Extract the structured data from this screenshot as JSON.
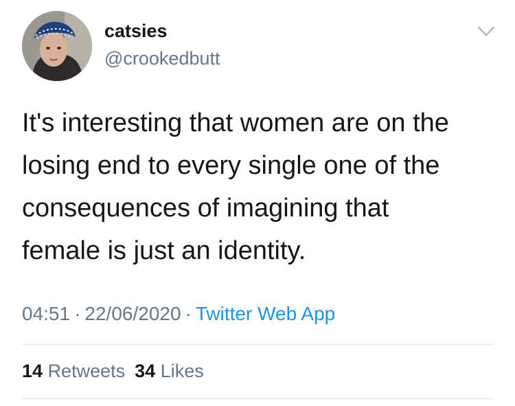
{
  "author": {
    "display_name": "catsies",
    "handle": "@crookedbutt",
    "avatar_icon": "profile-photo"
  },
  "tweet": {
    "text": "It's interesting that women are on the\nlosing end to every single one of the\nconsequences of imagining that\nfemale is just an identity."
  },
  "meta": {
    "time": "04:51",
    "separator": "·",
    "date": "22/06/2020",
    "source": "Twitter Web App"
  },
  "stats": {
    "retweets_count": "14",
    "retweets_label": "Retweets",
    "likes_count": "34",
    "likes_label": "Likes"
  },
  "colors": {
    "text": "#14171a",
    "secondary": "#657786",
    "link": "#1b95e0",
    "divider": "#e1e8ed"
  }
}
